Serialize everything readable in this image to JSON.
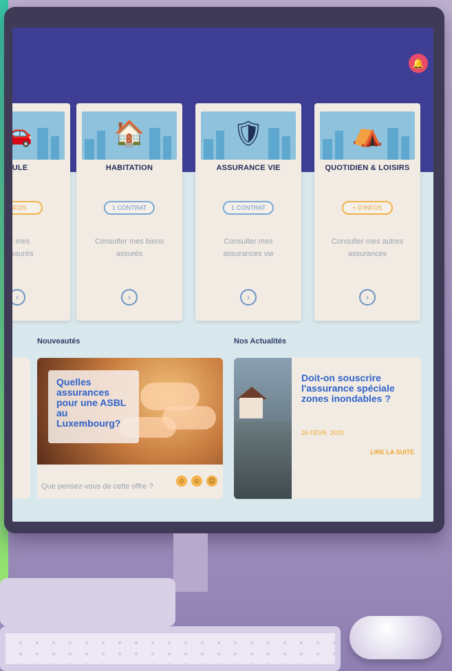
{
  "colors": {
    "topbar": "#3e3e95",
    "accent_blue": "#2f62c9",
    "accent_orange": "#f1a52d",
    "pill_blue": "#7aa7d6",
    "bell_red": "#e94b6a"
  },
  "cards": [
    {
      "title": "CULE",
      "pill": "INFOS",
      "pill_style": "orange",
      "desc_line1": "ter mes",
      "desc_line2": "s assurés",
      "icon": "car-icon"
    },
    {
      "title": "HABITATION",
      "pill": "1 CONTRAT",
      "pill_style": "blue",
      "desc_line1": "Consulter mes biens",
      "desc_line2": "assurés",
      "icon": "house-icon"
    },
    {
      "title": "ASSURANCE VIE",
      "pill": "1 CONTRAT",
      "pill_style": "blue",
      "desc_line1": "Consulter mes",
      "desc_line2": "assurances vie",
      "icon": "shield-icon"
    },
    {
      "title": "QUOTIDIEN & LOISIRS",
      "pill": "+ D'INFOS",
      "pill_style": "orange",
      "desc_line1": "Consulter mes autres",
      "desc_line2": "assurances",
      "icon": "tent-icon"
    }
  ],
  "sections": {
    "nouveautes": "Nouveautés",
    "actualites": "Nos Actualités"
  },
  "promo": {
    "caption": "Quelles assurances pour une ASBL au Luxembourg?",
    "question": "Que pensez-vous de cette offre ?"
  },
  "news": {
    "headline": "Doit-on souscrire l'assurance spéciale zones inondables ?",
    "date": "26 FÉVR. 2020",
    "read_more": "LIRE LA SUITE"
  }
}
